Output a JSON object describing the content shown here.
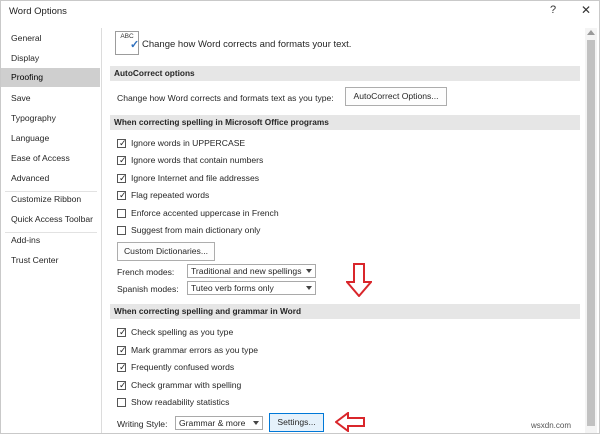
{
  "window": {
    "title": "Word Options",
    "help": "?",
    "close": "✕"
  },
  "sidebar": {
    "items": [
      {
        "label": "General",
        "selected": false
      },
      {
        "label": "Display",
        "selected": false
      },
      {
        "label": "Proofing",
        "selected": true
      },
      {
        "label": "Save",
        "selected": false
      },
      {
        "label": "Typography",
        "selected": false
      },
      {
        "label": "Language",
        "selected": false
      },
      {
        "label": "Ease of Access",
        "selected": false
      },
      {
        "label": "Advanced",
        "selected": false
      },
      {
        "label": "Customize Ribbon",
        "selected": false
      },
      {
        "label": "Quick Access Toolbar",
        "selected": false
      },
      {
        "label": "Add-ins",
        "selected": false
      },
      {
        "label": "Trust Center",
        "selected": false
      }
    ]
  },
  "header": {
    "icon_text": "ABC",
    "text": "Change how Word corrects and formats your text."
  },
  "autocorrect": {
    "title": "AutoCorrect options",
    "description": "Change how Word corrects and formats text as you type:",
    "button": "AutoCorrect Options..."
  },
  "office_spelling": {
    "title": "When correcting spelling in Microsoft Office programs",
    "options": [
      {
        "label": "Ignore words in UPPERCASE",
        "checked": true
      },
      {
        "label": "Ignore words that contain numbers",
        "checked": true
      },
      {
        "label": "Ignore Internet and file addresses",
        "checked": true
      },
      {
        "label": "Flag repeated words",
        "checked": true
      },
      {
        "label": "Enforce accented uppercase in French",
        "checked": false
      },
      {
        "label": "Suggest from main dictionary only",
        "checked": false
      }
    ],
    "dictionaries_button": "Custom Dictionaries...",
    "french_label": "French modes:",
    "french_value": "Traditional and new spellings",
    "spanish_label": "Spanish modes:",
    "spanish_value": "Tuteo verb forms only"
  },
  "word_spelling": {
    "title": "When correcting spelling and grammar in Word",
    "options": [
      {
        "label": "Check spelling as you type",
        "checked": true
      },
      {
        "label": "Mark grammar errors as you type",
        "checked": true
      },
      {
        "label": "Frequently confused words",
        "checked": true
      },
      {
        "label": "Check grammar with spelling",
        "checked": true
      },
      {
        "label": "Show readability statistics",
        "checked": false
      }
    ],
    "writing_style_label": "Writing Style:",
    "writing_style_value": "Grammar & more",
    "settings_button": "Settings..."
  },
  "watermark": "wsxdn.com",
  "colors": {
    "selected_bg": "#cfcfcf",
    "section_bg": "#e6e6e6",
    "annotation_red": "#d9262b",
    "button_highlight": "#e5f1fb"
  }
}
